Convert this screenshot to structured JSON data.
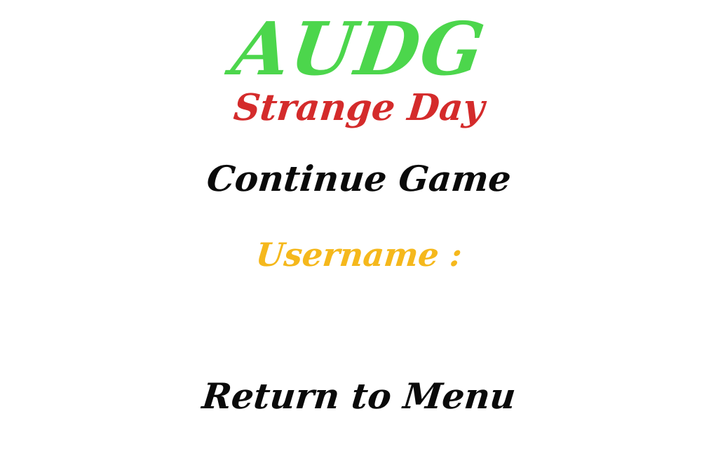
{
  "logo": {
    "title": "AUDG",
    "subtitle": "Strange Day"
  },
  "menu": {
    "continue_label": "Continue Game",
    "username_label": "Username :",
    "username_value": "",
    "return_label": "Return to Menu"
  },
  "colors": {
    "title": "#4cd64c",
    "subtitle": "#d42b2b",
    "menu_text": "#0a0a0a",
    "username_label": "#f5b81c",
    "background": "#ffffff"
  }
}
